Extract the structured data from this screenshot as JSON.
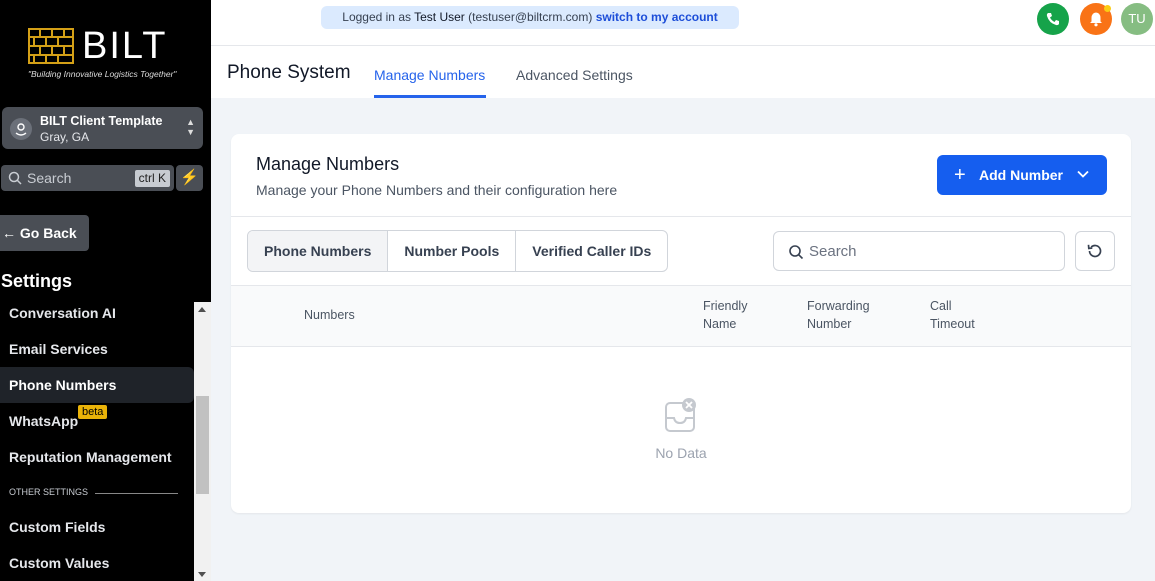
{
  "brand": {
    "name": "BILT",
    "tagline": "\"Building Innovative Logistics Together\""
  },
  "location": {
    "name": "BILT Client Template",
    "city": "Gray, GA"
  },
  "sidebar": {
    "search_placeholder": "Search",
    "search_shortcut": "ctrl K",
    "go_back": "Go Back",
    "section_title": "Settings",
    "items": [
      {
        "label": "Conversation AI"
      },
      {
        "label": "Email Services"
      },
      {
        "label": "Phone Numbers"
      },
      {
        "label": "WhatsApp",
        "badge": "beta"
      },
      {
        "label": "Reputation Management"
      }
    ],
    "other_settings_label": "OTHER SETTINGS",
    "other_items": [
      {
        "label": "Custom Fields"
      },
      {
        "label": "Custom Values"
      }
    ]
  },
  "topbar": {
    "logged_in_prefix": "Logged in as",
    "user_name": "Test User",
    "user_email": "(testuser@biltcrm.com)",
    "switch_link": "switch to my account",
    "avatar_initials": "TU"
  },
  "header": {
    "title": "Phone System",
    "tabs": [
      {
        "label": "Manage Numbers"
      },
      {
        "label": "Advanced Settings"
      }
    ]
  },
  "card": {
    "title": "Manage Numbers",
    "subtitle": "Manage your Phone Numbers and their configuration here",
    "add_button": "Add Number",
    "segments": [
      {
        "label": "Phone Numbers"
      },
      {
        "label": "Number Pools"
      },
      {
        "label": "Verified Caller IDs"
      }
    ],
    "search_placeholder": "Search",
    "columns": {
      "numbers": "Numbers",
      "friendly_1": "Friendly",
      "friendly_2": "Name",
      "forwarding_1": "Forwarding",
      "forwarding_2": "Number",
      "timeout_1": "Call",
      "timeout_2": "Timeout"
    },
    "empty_text": "No Data"
  },
  "colors": {
    "accent": "#155eef",
    "tab_active": "#2563eb",
    "phone": "#16a34a",
    "bell": "#f97316",
    "avatar": "#86bd82",
    "beta": "#eab308"
  }
}
